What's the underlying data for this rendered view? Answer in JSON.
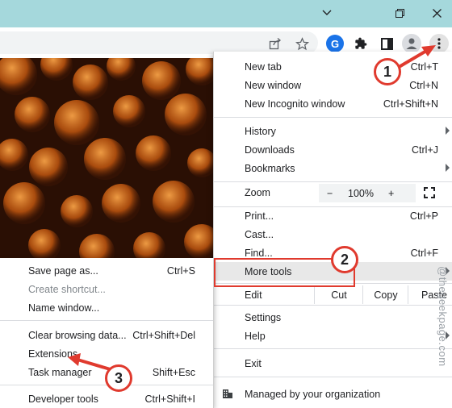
{
  "window": {
    "controls": [
      "minimize-icon",
      "restore-icon",
      "close-icon"
    ]
  },
  "toolbar": {
    "icons": [
      "share-icon",
      "star-icon",
      "grammarly-icon",
      "extensions-puzzle-icon",
      "side-panel-icon",
      "profile-avatar-icon",
      "kebab-menu-icon"
    ]
  },
  "menu": {
    "new_tab": {
      "label": "New tab",
      "shortcut": "Ctrl+T"
    },
    "new_window": {
      "label": "New window",
      "shortcut": "Ctrl+N"
    },
    "new_incognito": {
      "label": "New Incognito window",
      "shortcut": "Ctrl+Shift+N"
    },
    "history": {
      "label": "History"
    },
    "downloads": {
      "label": "Downloads",
      "shortcut": "Ctrl+J"
    },
    "bookmarks": {
      "label": "Bookmarks"
    },
    "zoom": {
      "label": "Zoom",
      "minus": "−",
      "value": "100%",
      "plus": "+"
    },
    "print": {
      "label": "Print...",
      "shortcut": "Ctrl+P"
    },
    "cast": {
      "label": "Cast..."
    },
    "find": {
      "label": "Find...",
      "shortcut": "Ctrl+F"
    },
    "more_tools": {
      "label": "More tools"
    },
    "edit": {
      "label": "Edit",
      "cut": "Cut",
      "copy": "Copy",
      "paste": "Paste"
    },
    "settings": {
      "label": "Settings"
    },
    "help": {
      "label": "Help"
    },
    "exit": {
      "label": "Exit"
    },
    "managed": {
      "label": "Managed by your organization"
    }
  },
  "submenu": {
    "save_page": {
      "label": "Save page as...",
      "shortcut": "Ctrl+S"
    },
    "create_shortcut": {
      "label": "Create shortcut..."
    },
    "name_window": {
      "label": "Name window..."
    },
    "clear_browsing": {
      "label": "Clear browsing data...",
      "shortcut": "Ctrl+Shift+Del"
    },
    "extensions": {
      "label": "Extensions"
    },
    "task_manager": {
      "label": "Task manager",
      "shortcut": "Shift+Esc"
    },
    "developer_tools": {
      "label": "Developer tools",
      "shortcut": "Ctrl+Shift+I"
    }
  },
  "callouts": {
    "one": "1",
    "two": "2",
    "three": "3"
  },
  "watermark": "@thegeekpage.com",
  "colors": {
    "titlebar": "#a5d8dc",
    "callout": "#e03a2e",
    "wallpaper": "#e07a1a",
    "grammarly": "#1a73e8"
  }
}
